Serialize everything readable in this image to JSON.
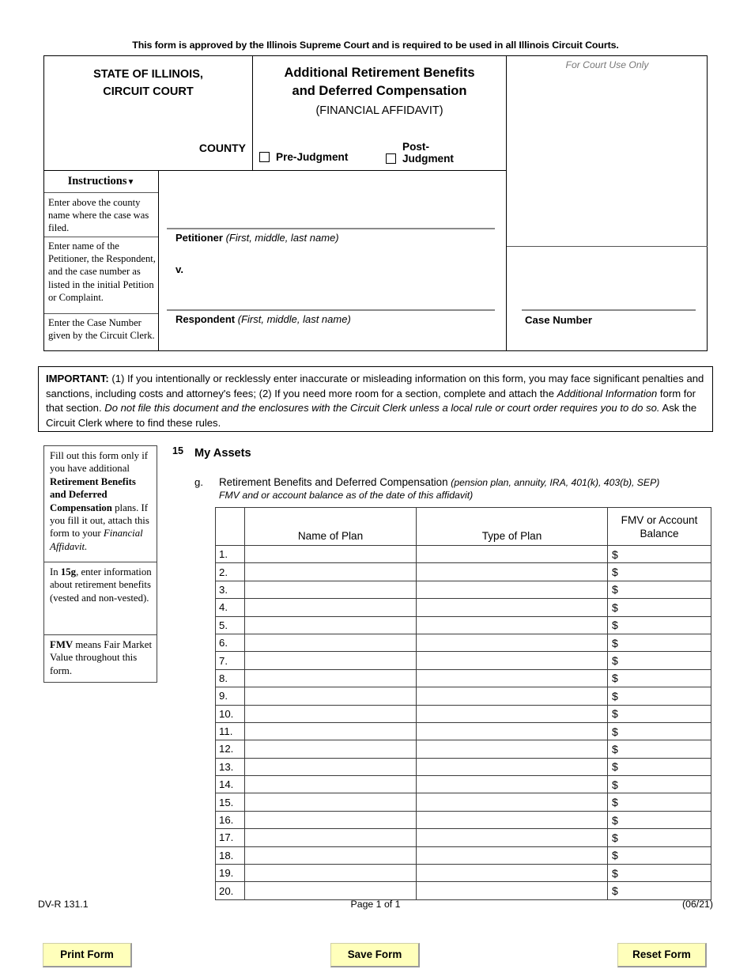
{
  "approval_notice": "This form is approved by the Illinois Supreme Court and is required to be used in all Illinois Circuit Courts.",
  "caption": {
    "state_line1": "STATE OF ILLINOIS,",
    "state_line2": "CIRCUIT COURT",
    "county_label": "COUNTY",
    "form_title_line1": "Additional Retirement Benefits",
    "form_title_line2": "and Deferred Compensation",
    "form_subtitle": "(FINANCIAL AFFIDAVIT)",
    "pre_judgment_label": "Pre-Judgment",
    "post_judgment_label_line1": "Post-",
    "post_judgment_label_line2": "Judgment",
    "court_use_only": "For Court Use Only",
    "instructions_header": "Instructions",
    "instructions_caret": "▼",
    "instruction_cells": [
      "Enter above the county name where the case was filed.",
      "Enter name of the Petitioner, the Respondent, and the case number as listed in the initial Petition or Complaint.",
      "Enter the Case Number given by the Circuit Clerk."
    ],
    "petitioner_label": "Petitioner",
    "petitioner_hint": "(First, middle, last name)",
    "versus": "v.",
    "respondent_label": "Respondent",
    "respondent_hint": "(First, middle, last name)",
    "case_number_label": "Case Number"
  },
  "important": {
    "lead": "IMPORTANT:",
    "part1": " (1) If you intentionally or recklessly enter inaccurate or misleading information on this form, you may face significant penalties and sanctions, including costs and attorney's fees; (2) If you need more room for a section, complete and attach the ",
    "italic1": "Additional Information",
    "part2": " form for that section. ",
    "italic2": "Do not file this document and the enclosures with the Circuit Clerk unless a local rule or court order requires you to do so.",
    "part3": " Ask the Circuit Clerk where to find these rules."
  },
  "side_notes": [
    {
      "segments": [
        {
          "text": "Fill out this form only if you have additional ",
          "style": "normal"
        },
        {
          "text": "Retirement Benefits and Deferred Compensation",
          "style": "bold"
        },
        {
          "text": " plans. If you fill it out, attach this form to your ",
          "style": "normal"
        },
        {
          "text": "Financial Affidavit.",
          "style": "italic"
        }
      ]
    },
    {
      "segments": [
        {
          "text": "In ",
          "style": "normal"
        },
        {
          "text": "15g",
          "style": "bold"
        },
        {
          "text": ", enter information about retirement benefits (vested and non-vested).",
          "style": "normal"
        }
      ]
    },
    {
      "segments": [
        {
          "text": "FMV",
          "style": "bold"
        },
        {
          "text": " means Fair Market Value throughout this form.",
          "style": "normal"
        }
      ]
    }
  ],
  "section": {
    "number": "15",
    "title": "My Assets",
    "item_letter": "g.",
    "item_title": "Retirement Benefits and Deferred Compensation",
    "item_hint": "(pension plan, annuity, IRA, 401(k), 403(b), SEP)",
    "item_sub": "FMV and or account balance as of the date of this affidavit)"
  },
  "assets_table": {
    "headers": {
      "num": "",
      "name_of_plan": "Name of Plan",
      "type_of_plan": "Type of Plan",
      "fmv_line1": "FMV or Account",
      "fmv_line2": "Balance"
    },
    "currency_symbol": "$",
    "rows": [
      {
        "num": "1.",
        "name": "",
        "type": "",
        "fmv": ""
      },
      {
        "num": "2.",
        "name": "",
        "type": "",
        "fmv": ""
      },
      {
        "num": "3.",
        "name": "",
        "type": "",
        "fmv": ""
      },
      {
        "num": "4.",
        "name": "",
        "type": "",
        "fmv": ""
      },
      {
        "num": "5.",
        "name": "",
        "type": "",
        "fmv": ""
      },
      {
        "num": "6.",
        "name": "",
        "type": "",
        "fmv": ""
      },
      {
        "num": "7.",
        "name": "",
        "type": "",
        "fmv": ""
      },
      {
        "num": "8.",
        "name": "",
        "type": "",
        "fmv": ""
      },
      {
        "num": "9.",
        "name": "",
        "type": "",
        "fmv": ""
      },
      {
        "num": "10.",
        "name": "",
        "type": "",
        "fmv": ""
      },
      {
        "num": "11.",
        "name": "",
        "type": "",
        "fmv": ""
      },
      {
        "num": "12.",
        "name": "",
        "type": "",
        "fmv": ""
      },
      {
        "num": "13.",
        "name": "",
        "type": "",
        "fmv": ""
      },
      {
        "num": "14.",
        "name": "",
        "type": "",
        "fmv": ""
      },
      {
        "num": "15.",
        "name": "",
        "type": "",
        "fmv": ""
      },
      {
        "num": "16.",
        "name": "",
        "type": "",
        "fmv": ""
      },
      {
        "num": "17.",
        "name": "",
        "type": "",
        "fmv": ""
      },
      {
        "num": "18.",
        "name": "",
        "type": "",
        "fmv": ""
      },
      {
        "num": "19.",
        "name": "",
        "type": "",
        "fmv": ""
      },
      {
        "num": "20.",
        "name": "",
        "type": "",
        "fmv": ""
      }
    ]
  },
  "footer": {
    "form_number": "DV-R 131.1",
    "page_text": "Page 1 of 1",
    "revision_date": "(06/21)"
  },
  "buttons": {
    "print": "Print Form",
    "save": "Save Form",
    "reset": "Reset Form",
    "background_color": "#ffffbb"
  }
}
